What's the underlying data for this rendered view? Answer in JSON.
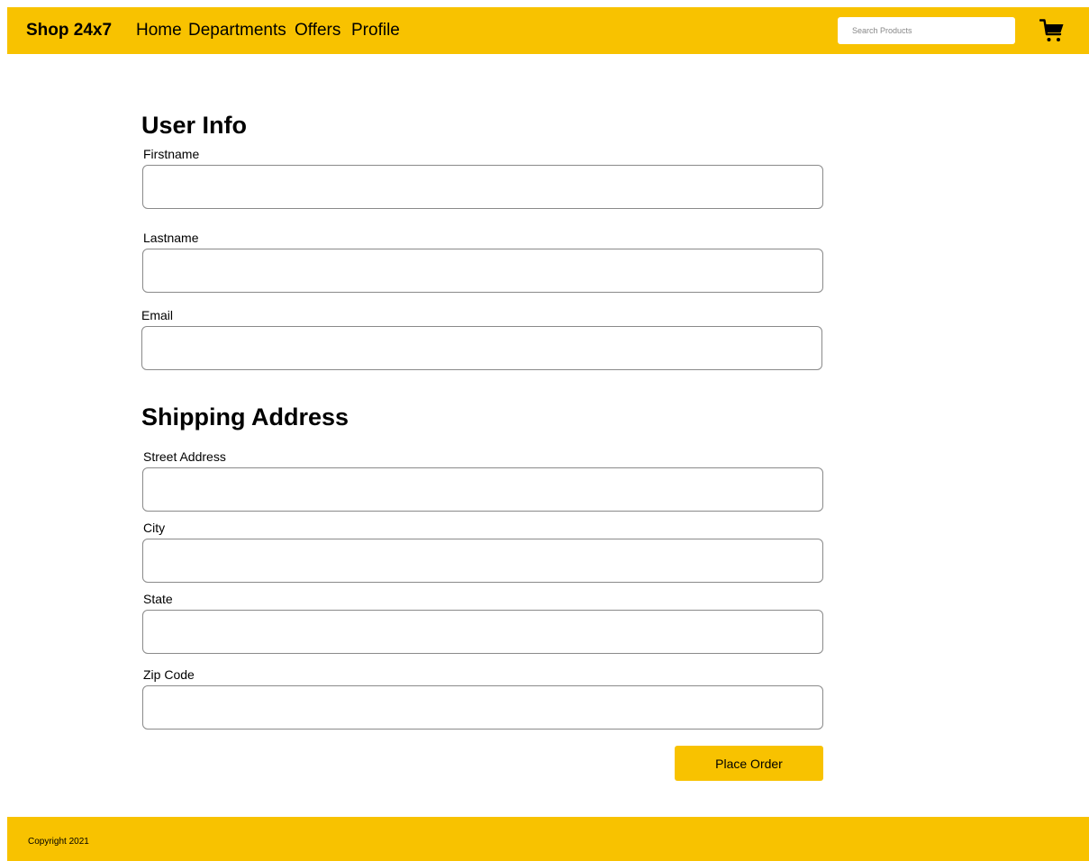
{
  "header": {
    "brand": "Shop 24x7",
    "nav": [
      "Home",
      "Departments",
      "Offers",
      "Profile"
    ],
    "search_placeholder": "Search Products",
    "cart_icon": "cart-icon"
  },
  "user_info": {
    "title": "User Info",
    "fields": [
      {
        "label": "Firstname",
        "value": ""
      },
      {
        "label": "Lastname",
        "value": ""
      },
      {
        "label": "Email",
        "value": ""
      }
    ]
  },
  "shipping": {
    "title": "Shipping Address",
    "fields": [
      {
        "label": "Street Address",
        "value": ""
      },
      {
        "label": "City",
        "value": ""
      },
      {
        "label": "State",
        "value": ""
      },
      {
        "label": "Zip Code",
        "value": ""
      }
    ]
  },
  "actions": {
    "place_order": "Place Order"
  },
  "footer": {
    "copyright": "Copyright 2021"
  },
  "colors": {
    "accent": "#f8c200",
    "field_border": "#8a8a8a"
  }
}
